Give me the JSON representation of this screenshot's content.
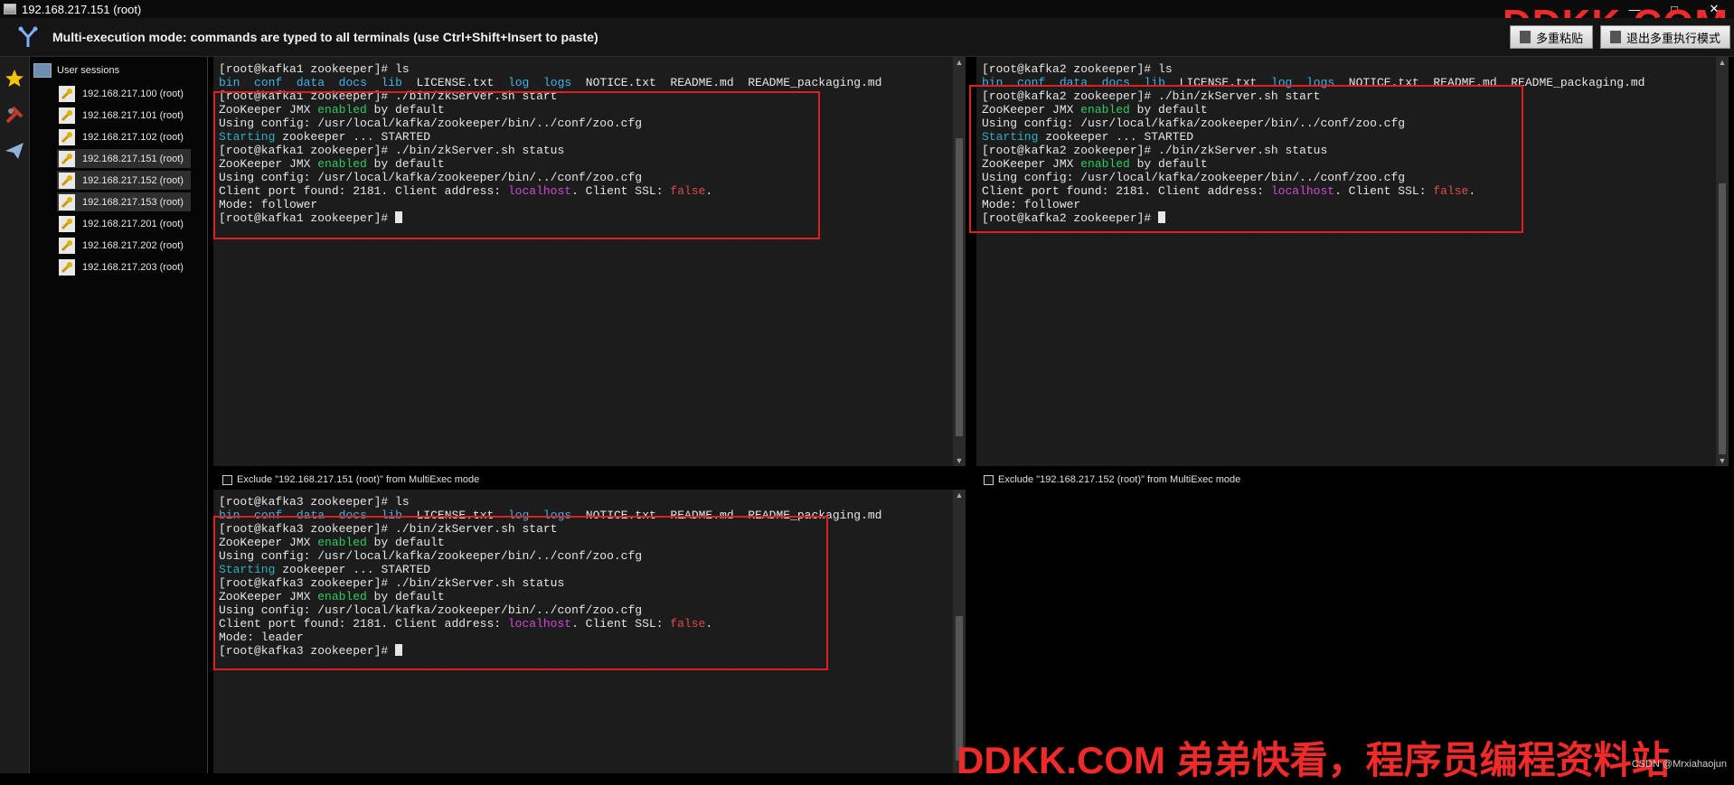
{
  "window": {
    "title": "192.168.217.151 (root)"
  },
  "banner": {
    "message": "Multi-execution mode: commands are typed to all terminals (use Ctrl+Shift+Insert to paste)",
    "button1": "多重粘贴",
    "button2": "退出多重执行模式"
  },
  "watermark": {
    "top": "DDKK.COM",
    "bottom": "DDKK.COM 弟弟快看，程序员编程资料站",
    "credit": "CSDN @Mrxiahaojun"
  },
  "sessions": {
    "root_label": "User sessions",
    "items": [
      {
        "label": "192.168.217.100 (root)",
        "selected": false
      },
      {
        "label": "192.168.217.101 (root)",
        "selected": false
      },
      {
        "label": "192.168.217.102 (root)",
        "selected": false
      },
      {
        "label": "192.168.217.151 (root)",
        "selected": true
      },
      {
        "label": "192.168.217.152 (root)",
        "selected": true
      },
      {
        "label": "192.168.217.153 (root)",
        "selected": true
      },
      {
        "label": "192.168.217.201 (root)",
        "selected": false
      },
      {
        "label": "192.168.217.202 (root)",
        "selected": false
      },
      {
        "label": "192.168.217.203 (root)",
        "selected": false
      }
    ]
  },
  "panes": {
    "p1": {
      "exclude_label": "Exclude \"192.168.217.151 (root)\" from MultiExec mode",
      "prompt": "[root@kafka1 zookeeper]# ",
      "mode": "Mode: follower"
    },
    "p2": {
      "exclude_label": "Exclude \"192.168.217.152 (root)\" from MultiExec mode",
      "prompt": "[root@kafka2 zookeeper]# ",
      "mode": "Mode: follower"
    },
    "p3": {
      "prompt": "[root@kafka3 zookeeper]# ",
      "mode": "Mode: leader"
    }
  },
  "term_common": {
    "cmd_ls": "ls",
    "ls_items": [
      "bin",
      "conf",
      "data",
      "docs",
      "lib",
      "LICENSE.txt",
      "log",
      "logs",
      "NOTICE.txt",
      "README.md",
      "README_packaging.md"
    ],
    "cmd_start": "./bin/zkServer.sh start",
    "cmd_status": "./bin/zkServer.sh status",
    "jmx_a": "ZooKeeper JMX ",
    "jmx_enabled": "enabled",
    "jmx_b": " by default",
    "config": "Using config: /usr/local/kafka/zookeeper/bin/../conf/zoo.cfg",
    "starting": "Starting",
    "started_rest": " zookeeper ... STARTED",
    "port_a": "Client port found: 2181. Client address: ",
    "localhost": "localhost",
    "port_b": ". Client SSL: ",
    "ssl_false": "false",
    "port_c": "."
  },
  "colors": {
    "highlight_box": "#e02020",
    "dir_blue": "#3fb3e8",
    "enabled_green": "#2ecc5a",
    "localhost_magenta": "#d04ad8",
    "false_red": "#e04a4a"
  }
}
